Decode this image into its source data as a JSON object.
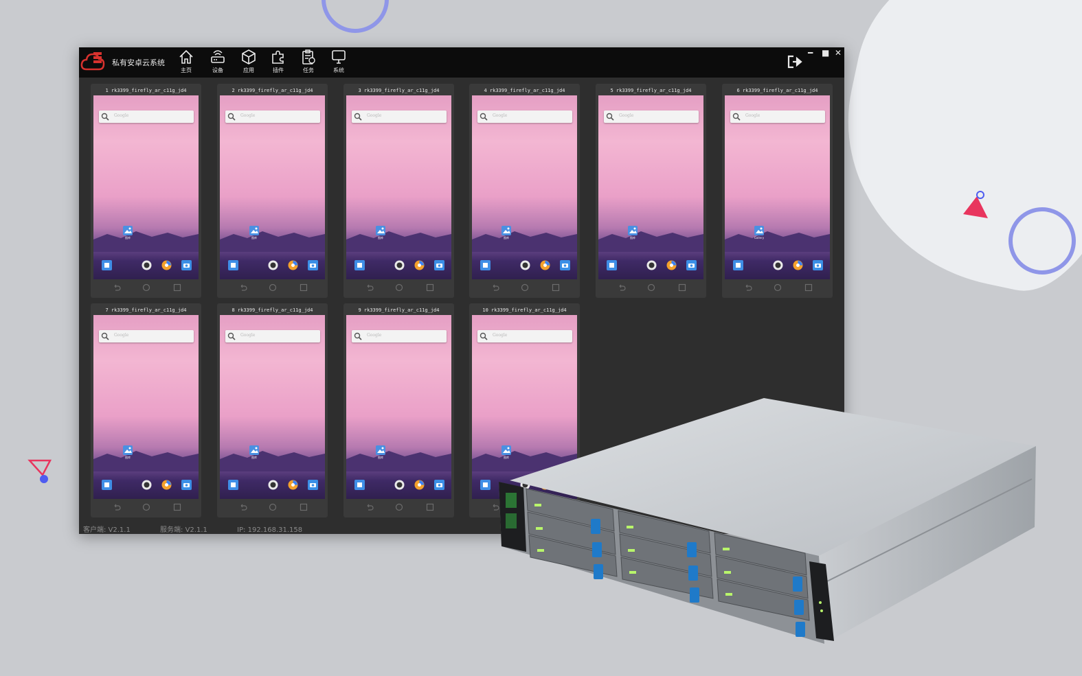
{
  "app": {
    "title": "私有安卓云系统",
    "nav": [
      {
        "label": "主页",
        "icon": "home-icon"
      },
      {
        "label": "设备",
        "icon": "router-icon"
      },
      {
        "label": "应用",
        "icon": "box-icon"
      },
      {
        "label": "插件",
        "icon": "puzzle-icon"
      },
      {
        "label": "任务",
        "icon": "clipboard-icon"
      },
      {
        "label": "系统",
        "icon": "monitor-icon"
      }
    ],
    "window_controls": {
      "minimize": "━",
      "maximize": "■",
      "close": "✕"
    }
  },
  "devices": [
    {
      "title": "1 rk3399_firefly_ar_c11g_jd4",
      "gallery_label": "图库",
      "search_placeholder": "Google"
    },
    {
      "title": "2 rk3399_firefly_ar_c11g_jd4",
      "gallery_label": "图库",
      "search_placeholder": "Google"
    },
    {
      "title": "3 rk3399_firefly_ar_c11g_jd4",
      "gallery_label": "图库",
      "search_placeholder": "Google"
    },
    {
      "title": "4 rk3399_firefly_ar_c11g_jd4",
      "gallery_label": "图库",
      "search_placeholder": "Google"
    },
    {
      "title": "5 rk3399_firefly_ar_c11g_jd4",
      "gallery_label": "图库",
      "search_placeholder": "Google"
    },
    {
      "title": "6 rk3399_firefly_ar_c11g_jd4",
      "gallery_label": "Gallery",
      "search_placeholder": "Google"
    },
    {
      "title": "7 rk3399_firefly_ar_c11g_jd4",
      "gallery_label": "图库",
      "search_placeholder": "Google"
    },
    {
      "title": "8 rk3399_firefly_ar_c11g_jd4",
      "gallery_label": "图库",
      "search_placeholder": "Google"
    },
    {
      "title": "9 rk3399_firefly_ar_c11g_jd4",
      "gallery_label": "图库",
      "search_placeholder": "Google"
    },
    {
      "title": "10 rk3399_firefly_ar_c11g_jd4",
      "gallery_label": "图库",
      "search_placeholder": "Google"
    }
  ],
  "footer": {
    "client": "客户端: V2.1.1",
    "server": "服务端: V2.1.1",
    "ip": "IP: 192.168.31.158"
  },
  "colors": {
    "titlebar": "#0c0c0c",
    "window_bg": "#2e2e2e",
    "logo_red": "#d8322e",
    "accent_ring": "#8f96e8",
    "accent_pink": "#e8355e"
  }
}
